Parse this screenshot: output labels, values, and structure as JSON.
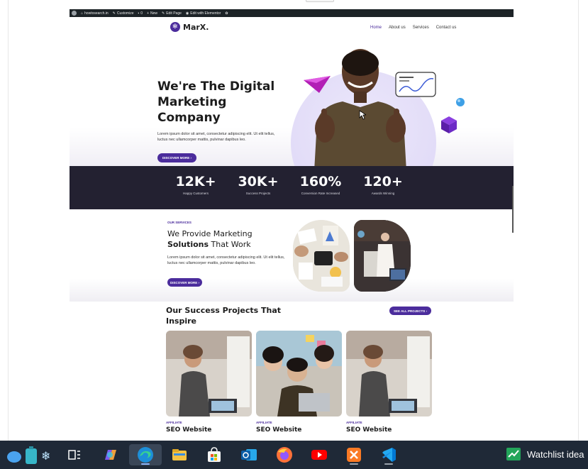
{
  "wp_admin_bar": {
    "items": [
      "howtosearch.in",
      "Customize",
      "0",
      "New",
      "Edit Page",
      "Edit with Elementor"
    ]
  },
  "site": {
    "logo_text": "MarX.",
    "nav": [
      "Home",
      "About us",
      "Services",
      "Contact us"
    ],
    "hero": {
      "title": "We're The Digital Marketing Company",
      "text": "Lorem ipsum dolor sit amet, consectetur adipiscing elit. Ut elit tellus, luctus nec ullamcorper mattis, pulvinar dapibus leo.",
      "button": "DISCOVER MORE ›"
    },
    "stats": [
      {
        "value": "12K+",
        "label": "Happy Customers"
      },
      {
        "value": "30K+",
        "label": "Success Projects"
      },
      {
        "value": "160%",
        "label": "Conversion Rate Increased"
      },
      {
        "value": "120+",
        "label": "Awards Winning"
      }
    ],
    "services": {
      "eyebrow": "OUR SERVICES",
      "title_line1": "We Provide Marketing",
      "title_bold": "Solutions",
      "title_rest": " That Work",
      "text": "Lorem ipsum dolor sit amet, consectetur adipiscing elit. Ut elit tellus, luctus nec ullamcorper mattis, pulvinar dapibus leo.",
      "button": "DISCOVER MORE ›"
    },
    "projects": {
      "title": "Our Success Projects That Inspire",
      "button": "SEE ALL PROJECTS ›",
      "cards": [
        {
          "tag": "AFFILIATE",
          "title": "SEO Website"
        },
        {
          "tag": "AFFILIATE",
          "title": "SEO Website"
        },
        {
          "tag": "AFFILIATE",
          "title": "SEO Website"
        }
      ]
    }
  },
  "taskbar": {
    "apps": [
      "weather-icon",
      "travel-icon",
      "task-view-icon",
      "copilot-icon",
      "edge-icon",
      "file-explorer-icon",
      "microsoft-store-icon",
      "outlook-icon",
      "firefox-icon",
      "youtube-icon",
      "xampp-icon",
      "vscode-icon"
    ],
    "widget_text": "Watchlist idea"
  },
  "colors": {
    "brand": "#4b2c9c",
    "stats_bg": "#232131",
    "taskbar": "#1f2937"
  }
}
